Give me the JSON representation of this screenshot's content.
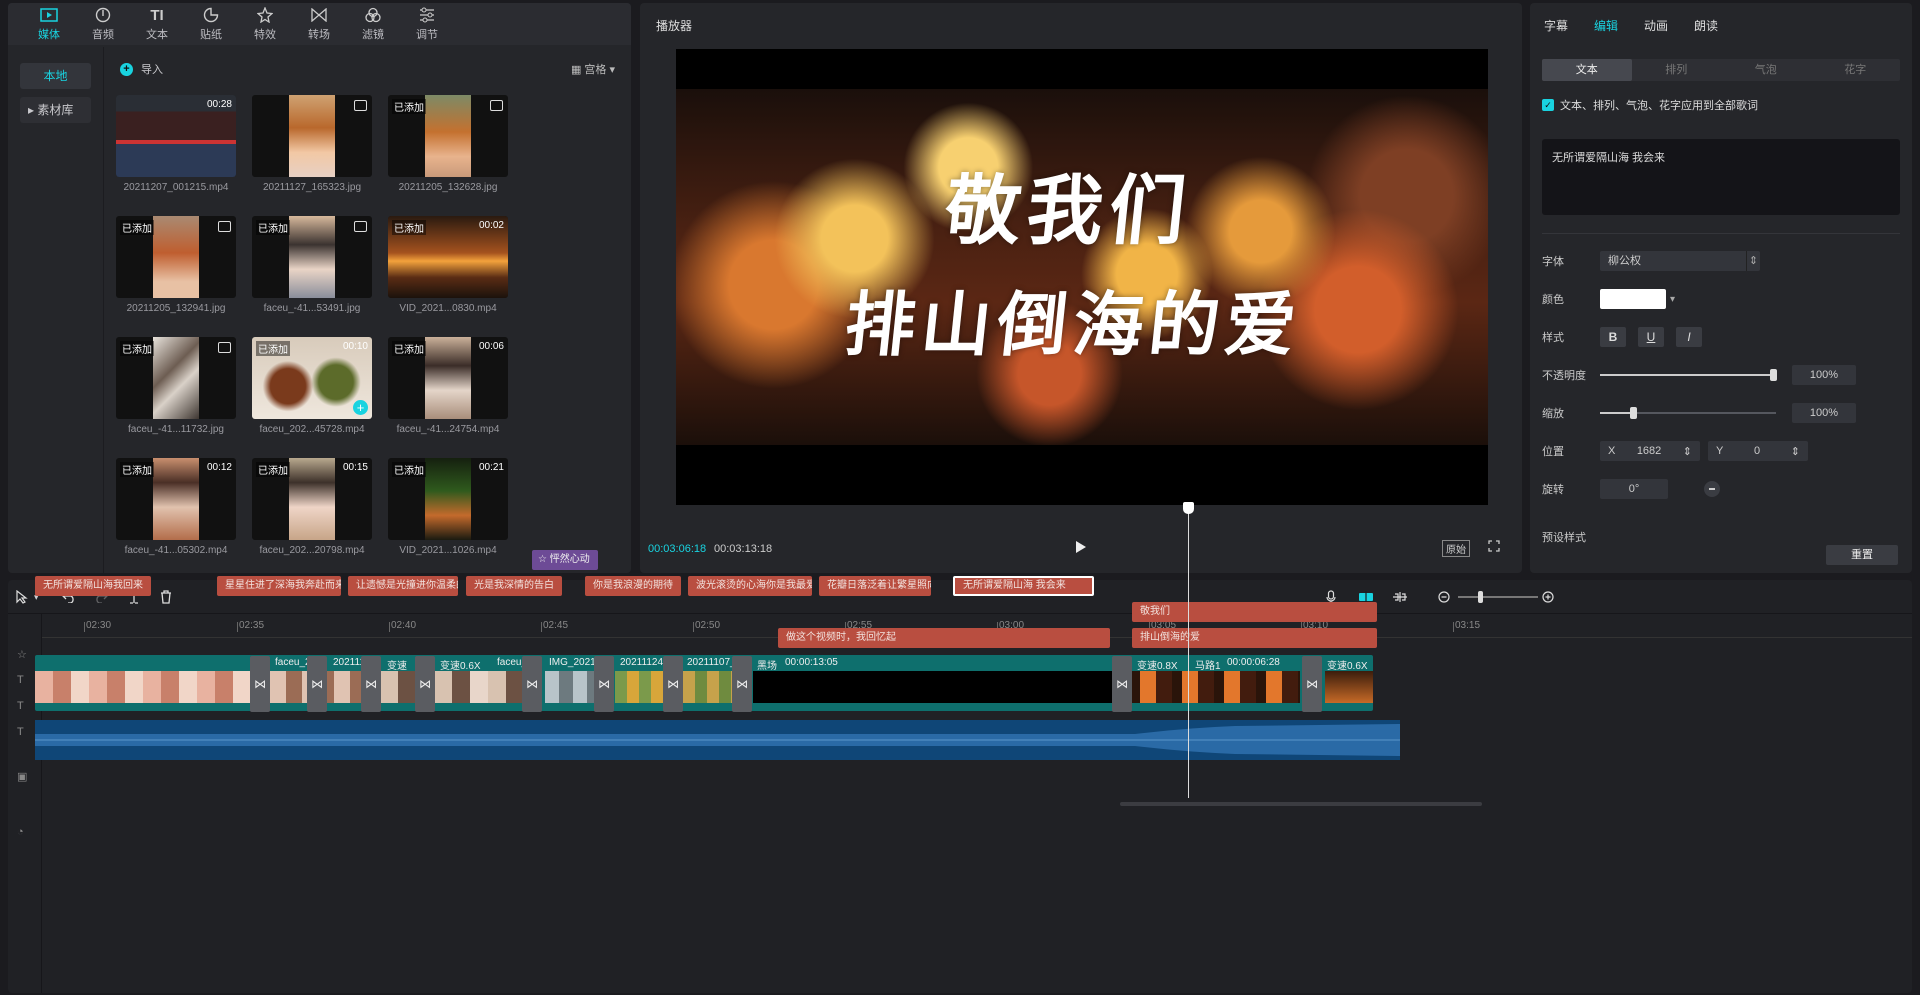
{
  "toolbar": {
    "items": [
      {
        "label": "媒体",
        "icon": "media-icon",
        "active": true
      },
      {
        "label": "音频",
        "icon": "audio-icon",
        "active": false
      },
      {
        "label": "文本",
        "icon": "text-icon",
        "active": false
      },
      {
        "label": "贴纸",
        "icon": "sticker-icon",
        "active": false
      },
      {
        "label": "特效",
        "icon": "effects-icon",
        "active": false
      },
      {
        "label": "转场",
        "icon": "transition-icon",
        "active": false
      },
      {
        "label": "滤镜",
        "icon": "filter-icon",
        "active": false
      },
      {
        "label": "调节",
        "icon": "adjust-icon",
        "active": false
      }
    ]
  },
  "media": {
    "sidebar": {
      "local": "本地",
      "library": "素材库"
    },
    "import_label": "导入",
    "view_label": "宫格",
    "items": [
      {
        "name": "20211207_001215.mp4",
        "tag": "",
        "duration": "00:28",
        "type": "video"
      },
      {
        "name": "20211127_165323.jpg",
        "tag": "",
        "duration": "",
        "type": "image"
      },
      {
        "name": "20211205_132628.jpg",
        "tag": "已添加",
        "duration": "",
        "type": "image"
      },
      {
        "name": "20211205_132941.jpg",
        "tag": "已添加",
        "duration": "",
        "type": "image"
      },
      {
        "name": "faceu_-41...53491.jpg",
        "tag": "已添加",
        "duration": "",
        "type": "image"
      },
      {
        "name": "VID_2021...0830.mp4",
        "tag": "已添加",
        "duration": "00:02",
        "type": "video"
      },
      {
        "name": "faceu_-41...11732.jpg",
        "tag": "已添加",
        "duration": "",
        "type": "image"
      },
      {
        "name": "faceu_202...45728.mp4",
        "tag": "已添加",
        "duration": "00:10",
        "type": "video"
      },
      {
        "name": "faceu_-41...24754.mp4",
        "tag": "已添加",
        "duration": "00:06",
        "type": "video"
      },
      {
        "name": "faceu_-41...05302.mp4",
        "tag": "已添加",
        "duration": "00:12",
        "type": "video"
      },
      {
        "name": "faceu_202...20798.mp4",
        "tag": "已添加",
        "duration": "00:15",
        "type": "video"
      },
      {
        "name": "VID_2021...1026.mp4",
        "tag": "已添加",
        "duration": "00:21",
        "type": "video"
      }
    ]
  },
  "player": {
    "title": "播放器",
    "subtitle_line1": "敬我们",
    "subtitle_line2": "排山倒海的爱",
    "current_time": "00:03:06:18",
    "total_time": "00:03:13:18",
    "ratio_label": "原始"
  },
  "props": {
    "tabs": [
      "字幕",
      "编辑",
      "动画",
      "朗读"
    ],
    "active_tab": "编辑",
    "subtabs": [
      "文本",
      "排列",
      "气泡",
      "花字"
    ],
    "apply_all_label": "文本、排列、气泡、花字应用到全部歌词",
    "text_value": "无所谓爱隔山海 我会来",
    "font_label": "字体",
    "font_value": "柳公权",
    "color_label": "颜色",
    "color_value": "#ffffff",
    "style_label": "样式",
    "style_buttons": [
      "B",
      "U",
      "I"
    ],
    "opacity_label": "不透明度",
    "opacity_value": "100%",
    "scale_label": "缩放",
    "scale_value": "100%",
    "position_label": "位置",
    "x_label": "X",
    "x_value": "1682",
    "y_label": "Y",
    "y_value": "0",
    "rotate_label": "旋转",
    "rotate_value": "0°",
    "preset_label": "预设样式",
    "reset_label": "重置"
  },
  "timeline": {
    "ruler": [
      "02:30",
      "02:35",
      "02:40",
      "02:45",
      "02:50",
      "02:55",
      "03:00",
      "03:05",
      "03:10",
      "03:15"
    ],
    "effect_clip": "怦然心动",
    "lyric_clips": [
      "无所谓爱隔山海我回来",
      "星星住进了深海我奔赴而来",
      "让遗憾是光撞进你温柔的",
      "光是我深情的告白",
      "你是我浪漫的期待",
      "波光滚烫的心海你是我最爱",
      "花瓣日落泛着让繁星照向我",
      "无所谓爱隔山海 我会来"
    ],
    "text_clips": [
      "敬我们",
      "做这个视频时，我回忆起",
      "排山倒海的爱"
    ],
    "video_labels": [
      "faceu_2",
      "202111",
      "变速",
      "变速0.6X",
      "faceu_",
      "IMG_20210",
      "20211124",
      "20211107_",
      "黑场",
      "00:00:13:05",
      "变速0.8X",
      "马路1",
      "00:00:06:28",
      "变速0.6X"
    ]
  }
}
